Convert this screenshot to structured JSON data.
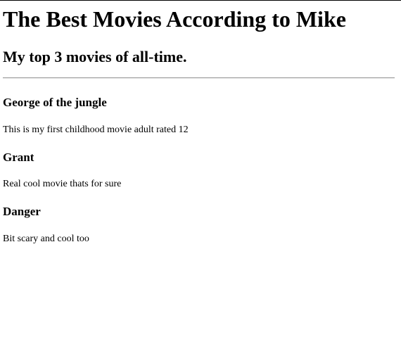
{
  "page": {
    "title": "The Best Movies According to Mike",
    "subtitle": "My top 3 movies of all-time."
  },
  "movies": [
    {
      "title": "George of the jungle",
      "description": "This is my first childhood movie adult rated 12"
    },
    {
      "title": "Grant",
      "description": "Real cool movie thats for sure"
    },
    {
      "title": "Danger",
      "description": "Bit scary and cool too"
    }
  ]
}
